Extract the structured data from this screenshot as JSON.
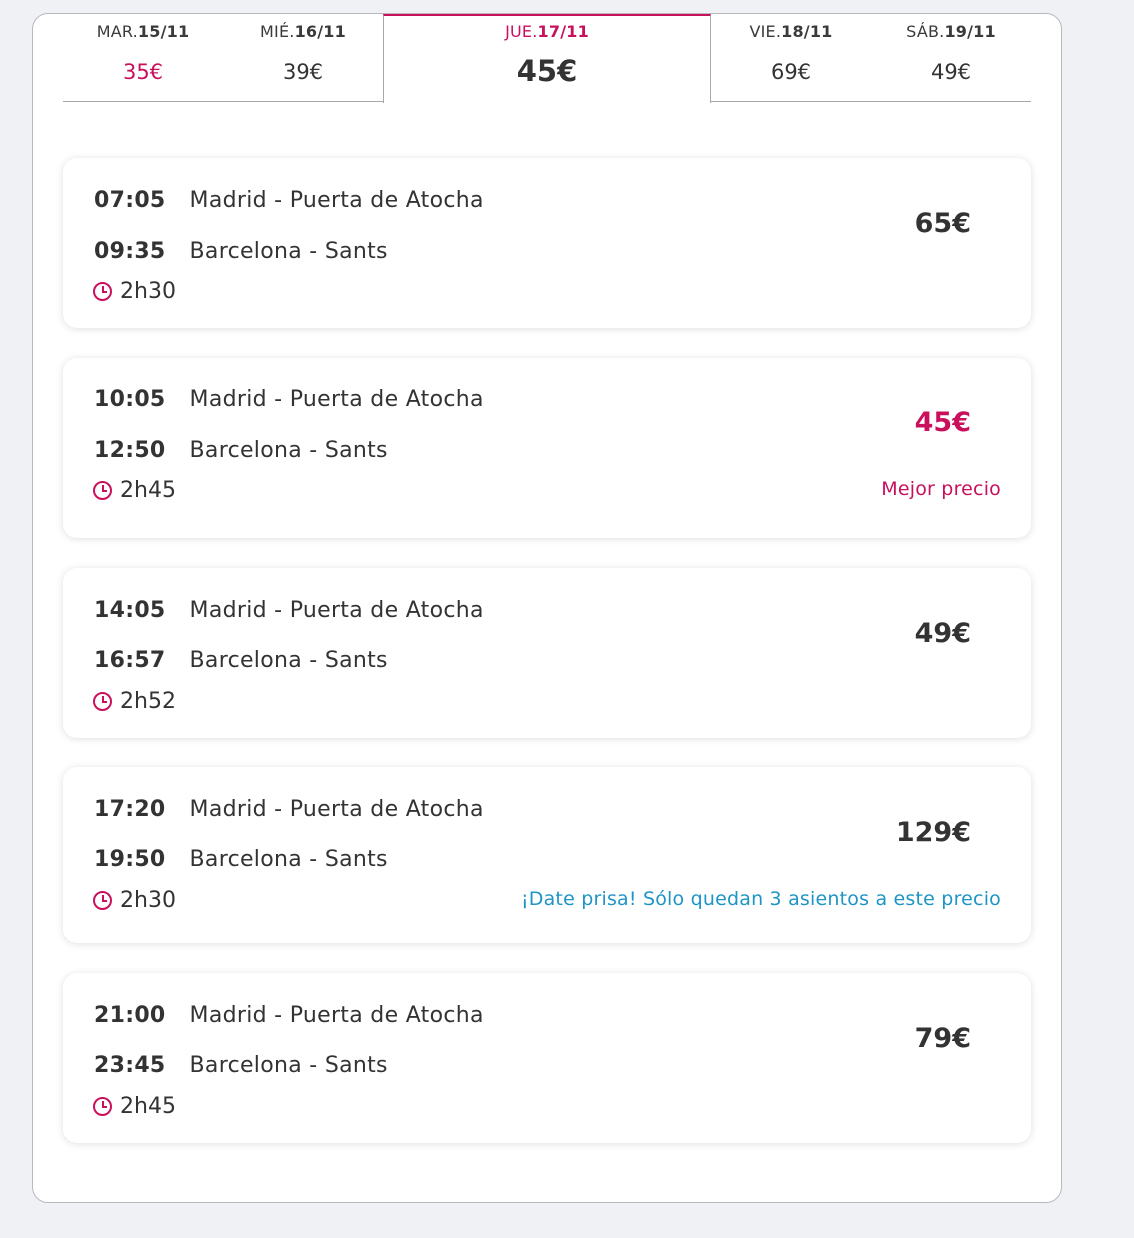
{
  "colors": {
    "accent": "#c8105d",
    "info": "#1e95c4",
    "text": "#333333"
  },
  "date_tabs": [
    {
      "day": "MAR.",
      "date": "15/11",
      "price": "35€",
      "cheapest": true
    },
    {
      "day": "MIÉ.",
      "date": "16/11",
      "price": "39€"
    },
    {
      "day": "JUE.",
      "date": "17/11",
      "price": "45€",
      "active": true
    },
    {
      "day": "VIE.",
      "date": "18/11",
      "price": "69€"
    },
    {
      "day": "SÁB.",
      "date": "19/11",
      "price": "49€"
    }
  ],
  "trips": [
    {
      "depart_time": "07:05",
      "depart_station": "Madrid - Puerta de Atocha",
      "arrive_time": "09:35",
      "arrive_station": "Barcelona - Sants",
      "duration": "2h30",
      "price": "65€"
    },
    {
      "depart_time": "10:05",
      "depart_station": "Madrid - Puerta de Atocha",
      "arrive_time": "12:50",
      "arrive_station": "Barcelona - Sants",
      "duration": "2h45",
      "price": "45€",
      "note": "Mejor precio"
    },
    {
      "depart_time": "14:05",
      "depart_station": "Madrid - Puerta de Atocha",
      "arrive_time": "16:57",
      "arrive_station": "Barcelona - Sants",
      "duration": "2h52",
      "price": "49€"
    },
    {
      "depart_time": "17:20",
      "depart_station": "Madrid - Puerta de Atocha",
      "arrive_time": "19:50",
      "arrive_station": "Barcelona - Sants",
      "duration": "2h30",
      "price": "129€",
      "note": "¡Date prisa! Sólo quedan 3 asientos a este precio"
    },
    {
      "depart_time": "21:00",
      "depart_station": "Madrid - Puerta de Atocha",
      "arrive_time": "23:45",
      "arrive_station": "Barcelona - Sants",
      "duration": "2h45",
      "price": "79€"
    }
  ],
  "icons": {
    "duration": "clock-icon"
  }
}
